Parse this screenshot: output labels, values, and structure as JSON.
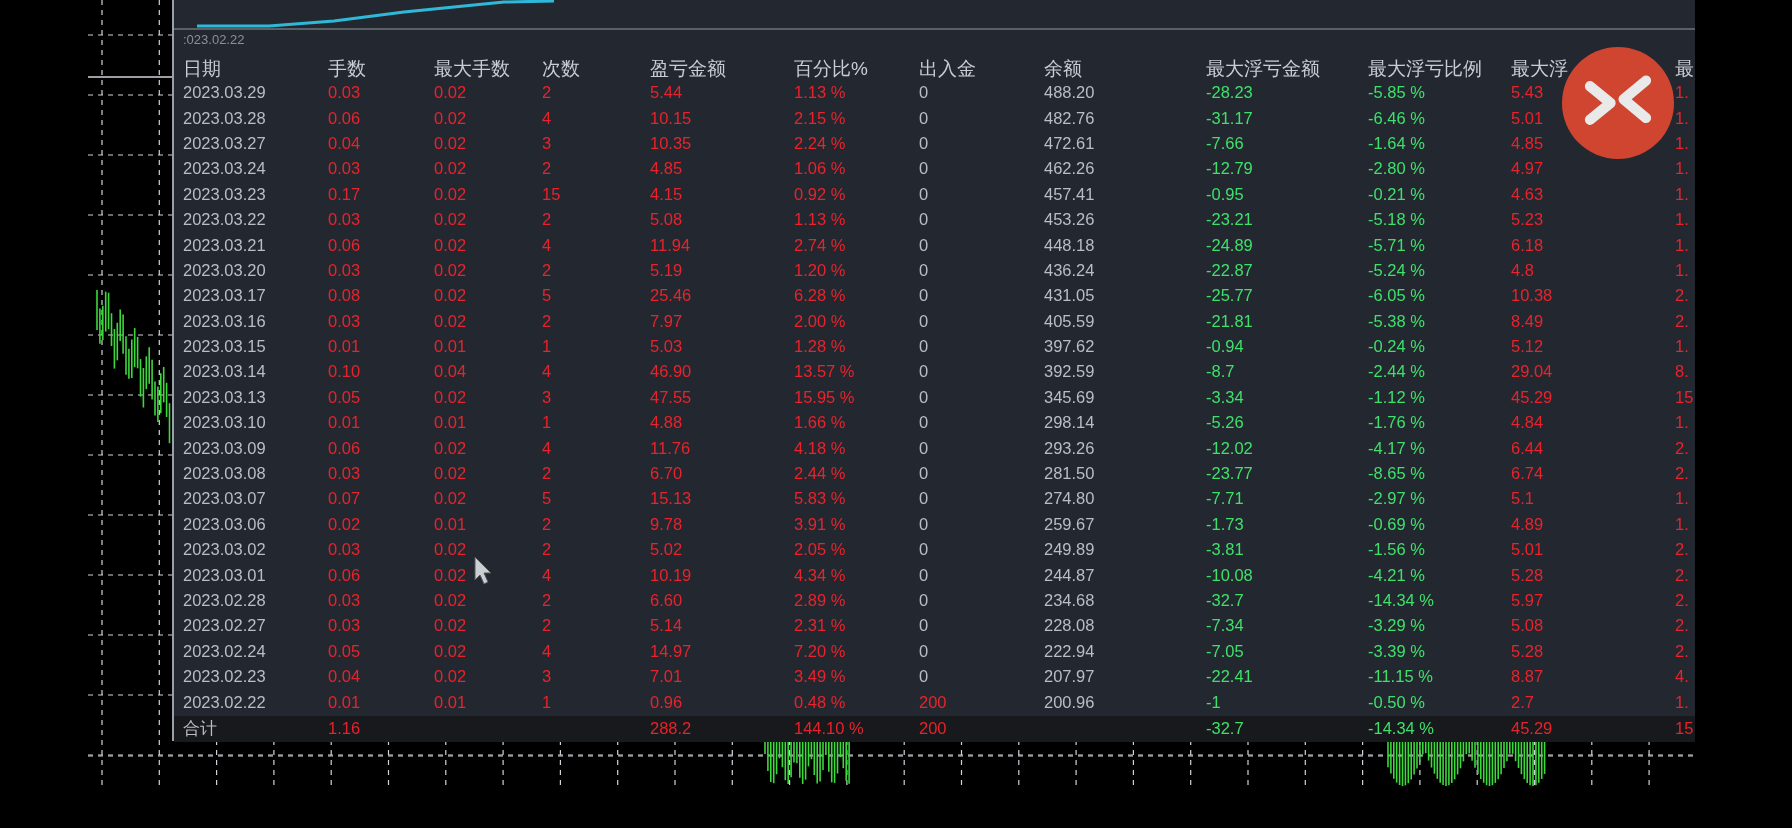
{
  "chart_axis_label": ":023.02.22",
  "columns": [
    {
      "label": "日期",
      "kind": "text"
    },
    {
      "label": "手数",
      "kind": "profit"
    },
    {
      "label": "最大手数",
      "kind": "profit"
    },
    {
      "label": "次数",
      "kind": "profit"
    },
    {
      "label": "盈亏金额",
      "kind": "profit"
    },
    {
      "label": "百分比%",
      "kind": "profit"
    },
    {
      "label": "出入金",
      "kind": "deposit"
    },
    {
      "label": "余额",
      "kind": "text"
    },
    {
      "label": "最大浮亏金额",
      "kind": "loss"
    },
    {
      "label": "最大浮亏比例",
      "kind": "loss"
    },
    {
      "label": "最大浮",
      "kind": "profit"
    },
    {
      "label": "最",
      "kind": "profit"
    }
  ],
  "rows": [
    {
      "kind": "plain",
      "cells": [
        "2023.03.29",
        "0.03",
        "0.02",
        "2",
        "5.44",
        "1.13 %",
        "0",
        "488.20",
        "-28.23",
        "-5.85 %",
        "5.43",
        "1."
      ]
    },
    {
      "kind": "plain",
      "cells": [
        "2023.03.28",
        "0.06",
        "0.02",
        "4",
        "10.15",
        "2.15 %",
        "0",
        "482.76",
        "-31.17",
        "-6.46 %",
        "5.01",
        "1."
      ]
    },
    {
      "kind": "plain",
      "cells": [
        "2023.03.27",
        "0.04",
        "0.02",
        "3",
        "10.35",
        "2.24 %",
        "0",
        "472.61",
        "-7.66",
        "-1.64 %",
        "4.85",
        "1."
      ]
    },
    {
      "kind": "plain",
      "cells": [
        "2023.03.24",
        "0.03",
        "0.02",
        "2",
        "4.85",
        "1.06 %",
        "0",
        "462.26",
        "-12.79",
        "-2.80 %",
        "4.97",
        "1."
      ]
    },
    {
      "kind": "plain",
      "cells": [
        "2023.03.23",
        "0.17",
        "0.02",
        "15",
        "4.15",
        "0.92 %",
        "0",
        "457.41",
        "-0.95",
        "-0.21 %",
        "4.63",
        "1."
      ]
    },
    {
      "kind": "plain",
      "cells": [
        "2023.03.22",
        "0.03",
        "0.02",
        "2",
        "5.08",
        "1.13 %",
        "0",
        "453.26",
        "-23.21",
        "-5.18 %",
        "5.23",
        "1."
      ]
    },
    {
      "kind": "plain",
      "cells": [
        "2023.03.21",
        "0.06",
        "0.02",
        "4",
        "11.94",
        "2.74 %",
        "0",
        "448.18",
        "-24.89",
        "-5.71 %",
        "6.18",
        "1."
      ]
    },
    {
      "kind": "plain",
      "cells": [
        "2023.03.20",
        "0.03",
        "0.02",
        "2",
        "5.19",
        "1.20 %",
        "0",
        "436.24",
        "-22.87",
        "-5.24 %",
        "4.8",
        "1."
      ]
    },
    {
      "kind": "plain",
      "cells": [
        "2023.03.17",
        "0.08",
        "0.02",
        "5",
        "25.46",
        "6.28 %",
        "0",
        "431.05",
        "-25.77",
        "-6.05 %",
        "10.38",
        "2."
      ]
    },
    {
      "kind": "plain",
      "cells": [
        "2023.03.16",
        "0.03",
        "0.02",
        "2",
        "7.97",
        "2.00 %",
        "0",
        "405.59",
        "-21.81",
        "-5.38 %",
        "8.49",
        "2."
      ]
    },
    {
      "kind": "plain",
      "cells": [
        "2023.03.15",
        "0.01",
        "0.01",
        "1",
        "5.03",
        "1.28 %",
        "0",
        "397.62",
        "-0.94",
        "-0.24 %",
        "5.12",
        "1."
      ]
    },
    {
      "kind": "plain",
      "cells": [
        "2023.03.14",
        "0.10",
        "0.04",
        "4",
        "46.90",
        "13.57 %",
        "0",
        "392.59",
        "-8.7",
        "-2.44 %",
        "29.04",
        "8."
      ]
    },
    {
      "kind": "plain",
      "cells": [
        "2023.03.13",
        "0.05",
        "0.02",
        "3",
        "47.55",
        "15.95 %",
        "0",
        "345.69",
        "-3.34",
        "-1.12 %",
        "45.29",
        "15"
      ]
    },
    {
      "kind": "plain",
      "cells": [
        "2023.03.10",
        "0.01",
        "0.01",
        "1",
        "4.88",
        "1.66 %",
        "0",
        "298.14",
        "-5.26",
        "-1.76 %",
        "4.84",
        "1."
      ]
    },
    {
      "kind": "plain",
      "cells": [
        "2023.03.09",
        "0.06",
        "0.02",
        "4",
        "11.76",
        "4.18 %",
        "0",
        "293.26",
        "-12.02",
        "-4.17 %",
        "6.44",
        "2."
      ]
    },
    {
      "kind": "plain",
      "cells": [
        "2023.03.08",
        "0.03",
        "0.02",
        "2",
        "6.70",
        "2.44 %",
        "0",
        "281.50",
        "-23.77",
        "-8.65 %",
        "6.74",
        "2."
      ]
    },
    {
      "kind": "plain",
      "cells": [
        "2023.03.07",
        "0.07",
        "0.02",
        "5",
        "15.13",
        "5.83 %",
        "0",
        "274.80",
        "-7.71",
        "-2.97 %",
        "5.1",
        "1."
      ]
    },
    {
      "kind": "plain",
      "cells": [
        "2023.03.06",
        "0.02",
        "0.01",
        "2",
        "9.78",
        "3.91 %",
        "0",
        "259.67",
        "-1.73",
        "-0.69 %",
        "4.89",
        "1."
      ]
    },
    {
      "kind": "plain",
      "cells": [
        "2023.03.02",
        "0.03",
        "0.02",
        "2",
        "5.02",
        "2.05 %",
        "0",
        "249.89",
        "-3.81",
        "-1.56 %",
        "5.01",
        "2."
      ]
    },
    {
      "kind": "plain",
      "cells": [
        "2023.03.01",
        "0.06",
        "0.02",
        "4",
        "10.19",
        "4.34 %",
        "0",
        "244.87",
        "-10.08",
        "-4.21 %",
        "5.28",
        "2."
      ]
    },
    {
      "kind": "plain",
      "cells": [
        "2023.02.28",
        "0.03",
        "0.02",
        "2",
        "6.60",
        "2.89 %",
        "0",
        "234.68",
        "-32.7",
        "-14.34 %",
        "5.97",
        "2."
      ]
    },
    {
      "kind": "plain",
      "cells": [
        "2023.02.27",
        "0.03",
        "0.02",
        "2",
        "5.14",
        "2.31 %",
        "0",
        "228.08",
        "-7.34",
        "-3.29 %",
        "5.08",
        "2."
      ]
    },
    {
      "kind": "plain",
      "cells": [
        "2023.02.24",
        "0.05",
        "0.02",
        "4",
        "14.97",
        "7.20 %",
        "0",
        "222.94",
        "-7.05",
        "-3.39 %",
        "5.28",
        "2."
      ]
    },
    {
      "kind": "plain",
      "cells": [
        "2023.02.23",
        "0.04",
        "0.02",
        "3",
        "7.01",
        "3.49 %",
        "0",
        "207.97",
        "-22.41",
        "-11.15 %",
        "8.87",
        "4."
      ]
    },
    {
      "kind": "deposit",
      "cells": [
        "2023.02.22",
        "0.01",
        "0.01",
        "1",
        "0.96",
        "0.48 %",
        "200",
        "200.96",
        "-1",
        "-0.50 %",
        "2.7",
        "1."
      ]
    }
  ],
  "total": {
    "kind": "deposit",
    "cells": [
      "合计",
      "1.16",
      null,
      null,
      "288.2",
      "144.10 %",
      "200",
      null,
      "-32.7",
      "-14.34 %",
      "45.29",
      "15"
    ]
  }
}
